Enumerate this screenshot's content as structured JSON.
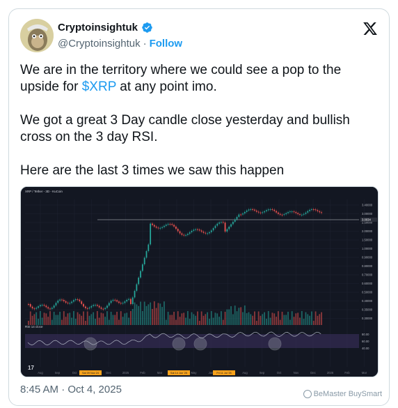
{
  "author": {
    "display_name": "Cryptoinsightuk",
    "handle": "@Cryptoinsightuk",
    "separator": "·",
    "follow_label": "Follow"
  },
  "tweet": {
    "line1_before": "We are in the territory where we could see a pop to the upside for ",
    "cashtag": "$XRP",
    "line1_after": " at any point imo.",
    "paragraph2": "We got a great 3 Day candle close yesterday and bullish cross on the 3 day RSI.",
    "paragraph3": "Here are the last 3 times we saw this happen"
  },
  "chart_data": {
    "type": "line",
    "title": "XRP / Tether - 3D - KuCoin",
    "indicator": "RSI 14 close",
    "price_labels": [
      "3.40000",
      "3.00000",
      "2.50000",
      "2.00000",
      "1.50000",
      "1.00000",
      "0.90000",
      "0.80000",
      "0.70000",
      "0.60000",
      "0.50000",
      "0.40000",
      "0.35000",
      "0.30000"
    ],
    "current_price": "3.0034",
    "rsi_labels": [
      "80.00",
      "60.00",
      "40.00"
    ],
    "x_labels": [
      "Aug",
      "Sep",
      "Oct",
      "Nov",
      "Dec",
      "2025",
      "Feb",
      "Mar",
      "Apr",
      "May",
      "Jun",
      "Jul",
      "Aug",
      "Sep",
      "Oct",
      "Nov",
      "Dec",
      "2026",
      "Feb",
      "Mar"
    ],
    "highlight_dates": [
      "Sat 09 Nov 24",
      "Sat 14 Jun '25",
      "Fri 11 Jul '25"
    ],
    "colors": {
      "up": "#26a69a",
      "down": "#ef5350",
      "rsi": "#b0b6c4",
      "rsi_band": "#3b2f5e",
      "background": "#131722"
    }
  },
  "meta": {
    "timestamp": "8:45 AM · Oct 4, 2025",
    "watermark": "BeMaster BuySmart"
  }
}
